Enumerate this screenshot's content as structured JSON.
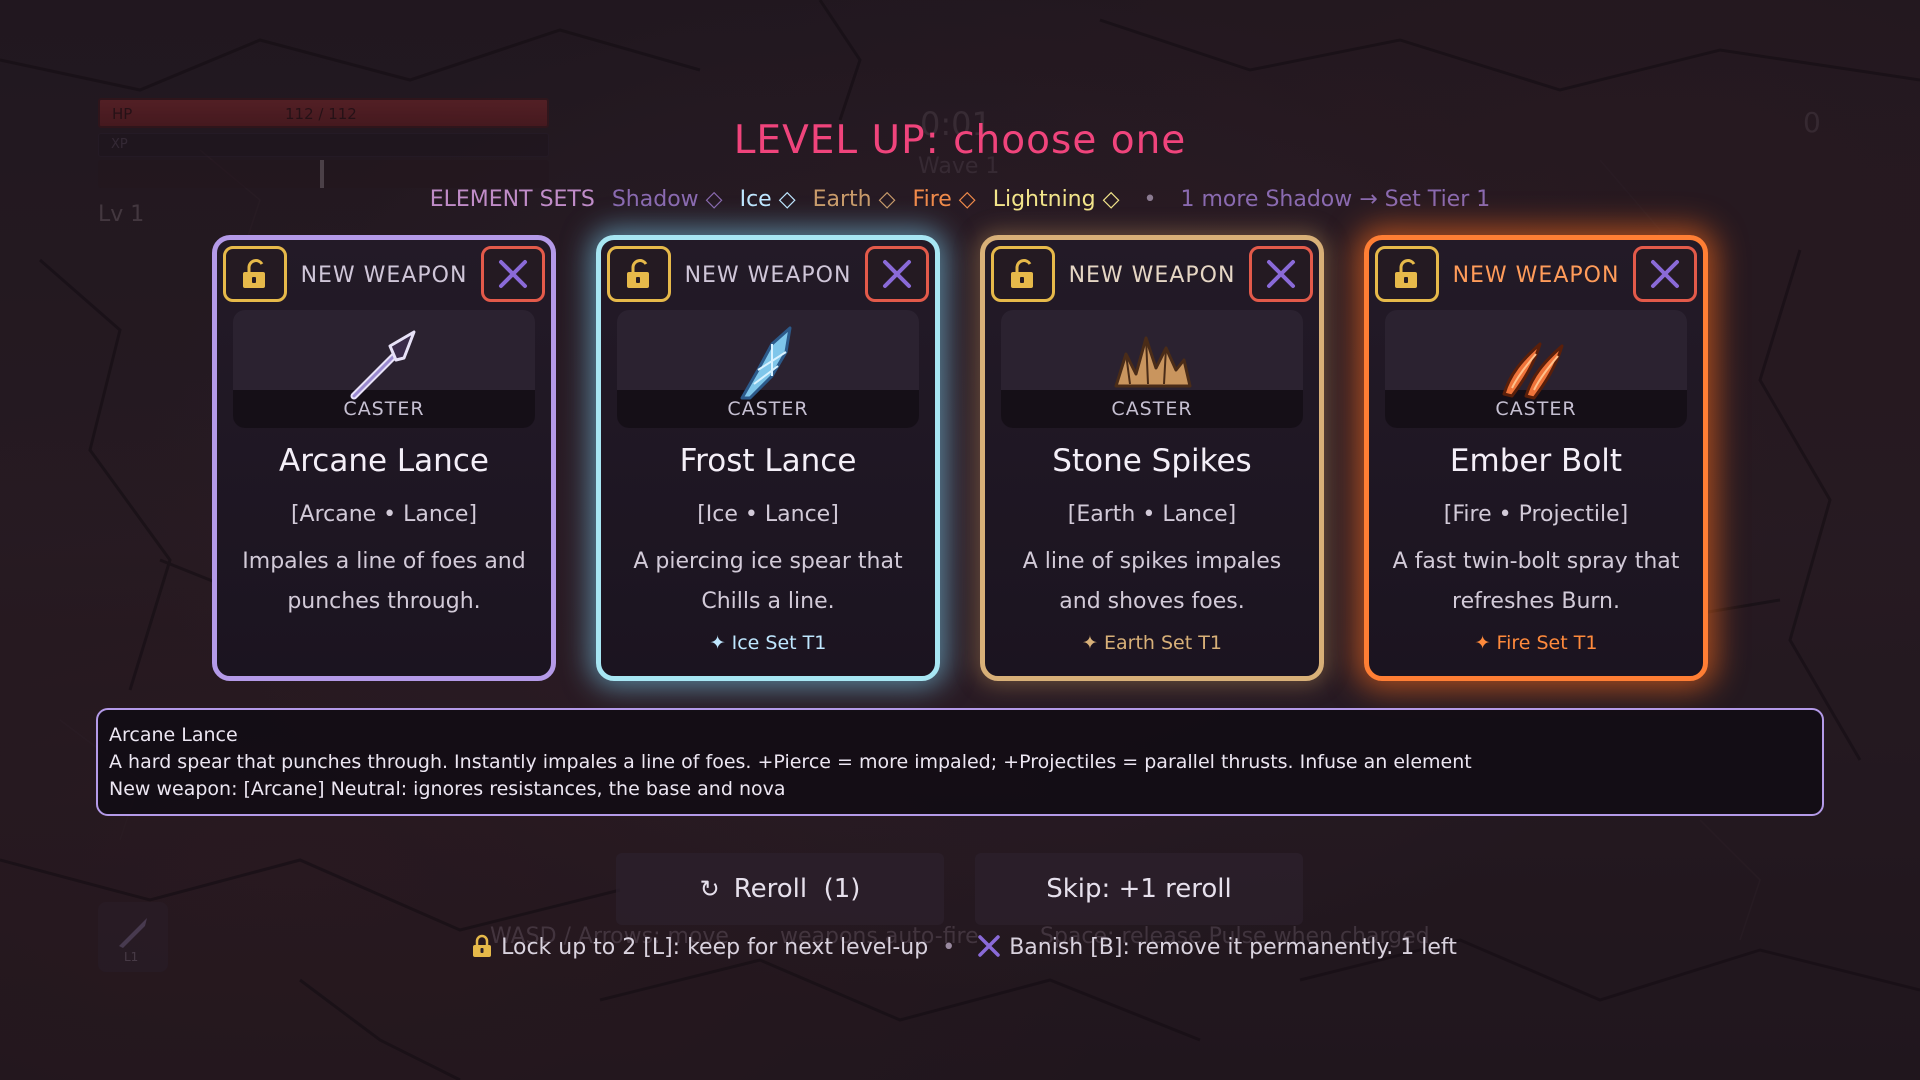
{
  "hud": {
    "hp_label": "HP",
    "hp_value": "112 / 112",
    "xp_label": "XP",
    "level": "Lv 1",
    "timer": "0:01",
    "wave": "Wave 1",
    "score": "0",
    "skill_slot_label": "L1"
  },
  "title": "LEVEL UP: choose one",
  "element_sets": {
    "label": "ELEMENT SETS",
    "items": [
      {
        "name": "Shadow ◇",
        "color": "#8a6ab0"
      },
      {
        "name": "Ice ◇",
        "color": "#bfe7ff"
      },
      {
        "name": "Earth ◇",
        "color": "#c99b6a"
      },
      {
        "name": "Fire ◇",
        "color": "#f08a4a"
      },
      {
        "name": "Lightning ◇",
        "color": "#f2e48a"
      }
    ],
    "separator": "•",
    "hint": "1 more Shadow → Set Tier 1"
  },
  "cards": [
    {
      "header": "NEW WEAPON",
      "icon": "lance-icon",
      "category": "CASTER",
      "name": "Arcane Lance",
      "tags": "[Arcane • Lance]",
      "description": "Impales a line of foes and punches through.",
      "set_tag": "",
      "border_color": "#b49ae8"
    },
    {
      "header": "NEW WEAPON",
      "icon": "ice-spear-icon",
      "category": "CASTER",
      "name": "Frost Lance",
      "tags": "[Ice • Lance]",
      "description": "A piercing ice spear that Chills a line.",
      "set_tag": "✦ Ice Set T1",
      "border_color": "#a7e6f3"
    },
    {
      "header": "NEW WEAPON",
      "icon": "stone-spikes-icon",
      "category": "CASTER",
      "name": "Stone Spikes",
      "tags": "[Earth • Lance]",
      "description": "A line of spikes impales and shoves foes.",
      "set_tag": "✦ Earth Set T1",
      "border_color": "#d8b078"
    },
    {
      "header": "NEW WEAPON",
      "icon": "ember-bolt-icon",
      "category": "CASTER",
      "name": "Ember Bolt",
      "tags": "[Fire • Projectile]",
      "description": "A fast twin-bolt spray that refreshes Burn.",
      "set_tag": "✦ Fire Set T1",
      "border_color": "#ff7e34"
    }
  ],
  "detail": {
    "line1": "Arcane Lance",
    "line2": "A hard spear that punches through. Instantly impales a line of foes. +Pierce = more impaled; +Projectiles = parallel thrusts. Infuse an element",
    "line3": "New weapon: [Arcane] Neutral: ignores resistances, the base and nova"
  },
  "buttons": {
    "reroll_glyph": "↻",
    "reroll_label": "Reroll  (1)",
    "skip_label": "Skip: +1 reroll"
  },
  "footer": {
    "lock_text": "Lock up to 2 [L]: keep for next level-up",
    "dot": "•",
    "banish_text": "Banish [B]: remove it permanently. 1 left"
  },
  "colors": {
    "title": "#f0447c",
    "lock": "#e6b94a",
    "banish_border": "#e35a4a",
    "banish_x": "#8a6ad8"
  }
}
